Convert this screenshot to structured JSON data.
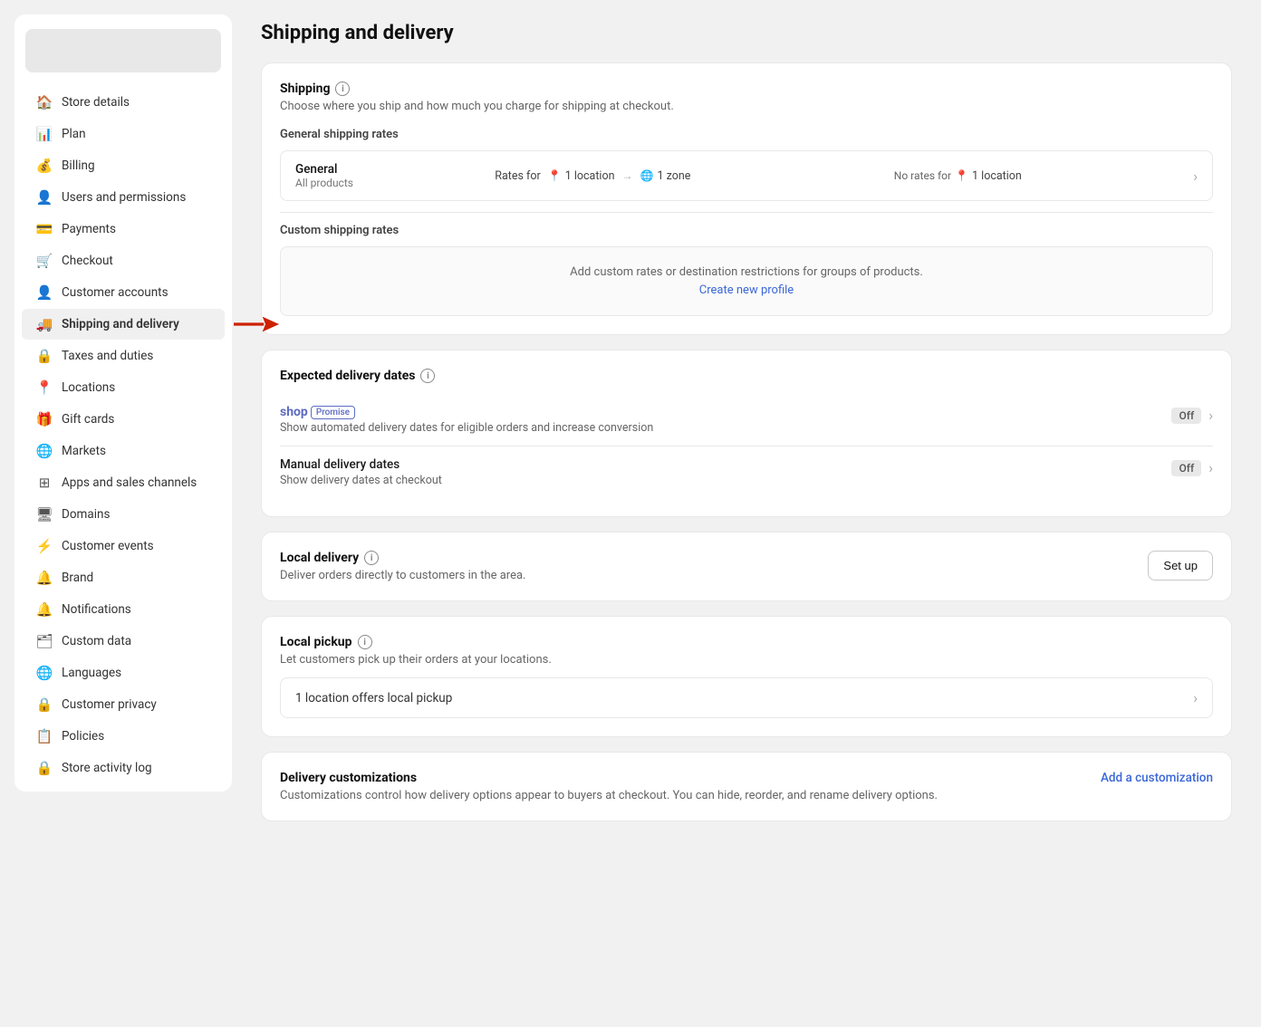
{
  "sidebar": {
    "logo_alt": "Shop logo",
    "items": [
      {
        "id": "store-details",
        "label": "Store details",
        "icon": "🏠"
      },
      {
        "id": "plan",
        "label": "Plan",
        "icon": "📊"
      },
      {
        "id": "billing",
        "label": "Billing",
        "icon": "💰"
      },
      {
        "id": "users-permissions",
        "label": "Users and permissions",
        "icon": "👤"
      },
      {
        "id": "payments",
        "label": "Payments",
        "icon": "💳"
      },
      {
        "id": "checkout",
        "label": "Checkout",
        "icon": "🛒"
      },
      {
        "id": "customer-accounts",
        "label": "Customer accounts",
        "icon": "👤"
      },
      {
        "id": "shipping-delivery",
        "label": "Shipping and delivery",
        "icon": "🚚",
        "active": true
      },
      {
        "id": "taxes-duties",
        "label": "Taxes and duties",
        "icon": "🔒"
      },
      {
        "id": "locations",
        "label": "Locations",
        "icon": "📍"
      },
      {
        "id": "gift-cards",
        "label": "Gift cards",
        "icon": "🎁"
      },
      {
        "id": "markets",
        "label": "Markets",
        "icon": "🌐"
      },
      {
        "id": "apps-sales",
        "label": "Apps and sales channels",
        "icon": "⊞"
      },
      {
        "id": "domains",
        "label": "Domains",
        "icon": "🖥"
      },
      {
        "id": "customer-events",
        "label": "Customer events",
        "icon": "⚡"
      },
      {
        "id": "brand",
        "label": "Brand",
        "icon": "🔔"
      },
      {
        "id": "notifications",
        "label": "Notifications",
        "icon": "🔔"
      },
      {
        "id": "custom-data",
        "label": "Custom data",
        "icon": "🗂"
      },
      {
        "id": "languages",
        "label": "Languages",
        "icon": "🌐"
      },
      {
        "id": "customer-privacy",
        "label": "Customer privacy",
        "icon": "🔒"
      },
      {
        "id": "policies",
        "label": "Policies",
        "icon": "📋"
      },
      {
        "id": "store-activity",
        "label": "Store activity log",
        "icon": "🔒"
      }
    ]
  },
  "page": {
    "title": "Shipping and delivery",
    "shipping_section": {
      "title": "Shipping",
      "subtitle": "Choose where you ship and how much you charge for shipping at checkout.",
      "general_rates_label": "General shipping rates",
      "general_row": {
        "title": "General",
        "subtitle": "All products",
        "rates_for_label": "Rates for",
        "rates_for_location": "1 location",
        "rates_for_zone": "1 zone",
        "no_rates_label": "No rates for",
        "no_rates_location": "1 location"
      },
      "custom_rates_label": "Custom shipping rates",
      "custom_rates_text": "Add custom rates or destination restrictions for groups of products.",
      "create_profile_link": "Create new profile"
    },
    "expected_delivery": {
      "title": "Expected delivery dates",
      "shop_promise": {
        "shop_text": "shop",
        "promise_badge": "Promise",
        "subtitle": "Show automated delivery dates for eligible orders and increase conversion",
        "toggle": "Off"
      },
      "manual_delivery": {
        "title": "Manual delivery dates",
        "subtitle": "Show delivery dates at checkout",
        "toggle": "Off"
      }
    },
    "local_delivery": {
      "title": "Local delivery",
      "subtitle": "Deliver orders directly to customers in the area.",
      "setup_button": "Set up"
    },
    "local_pickup": {
      "title": "Local pickup",
      "subtitle": "Let customers pick up their orders at your locations.",
      "location_row": "1 location offers local pickup"
    },
    "delivery_customizations": {
      "title": "Delivery customizations",
      "add_link": "Add a customization",
      "subtitle": "Customizations control how delivery options appear to buyers at checkout. You can hide, reorder, and rename delivery options."
    }
  }
}
